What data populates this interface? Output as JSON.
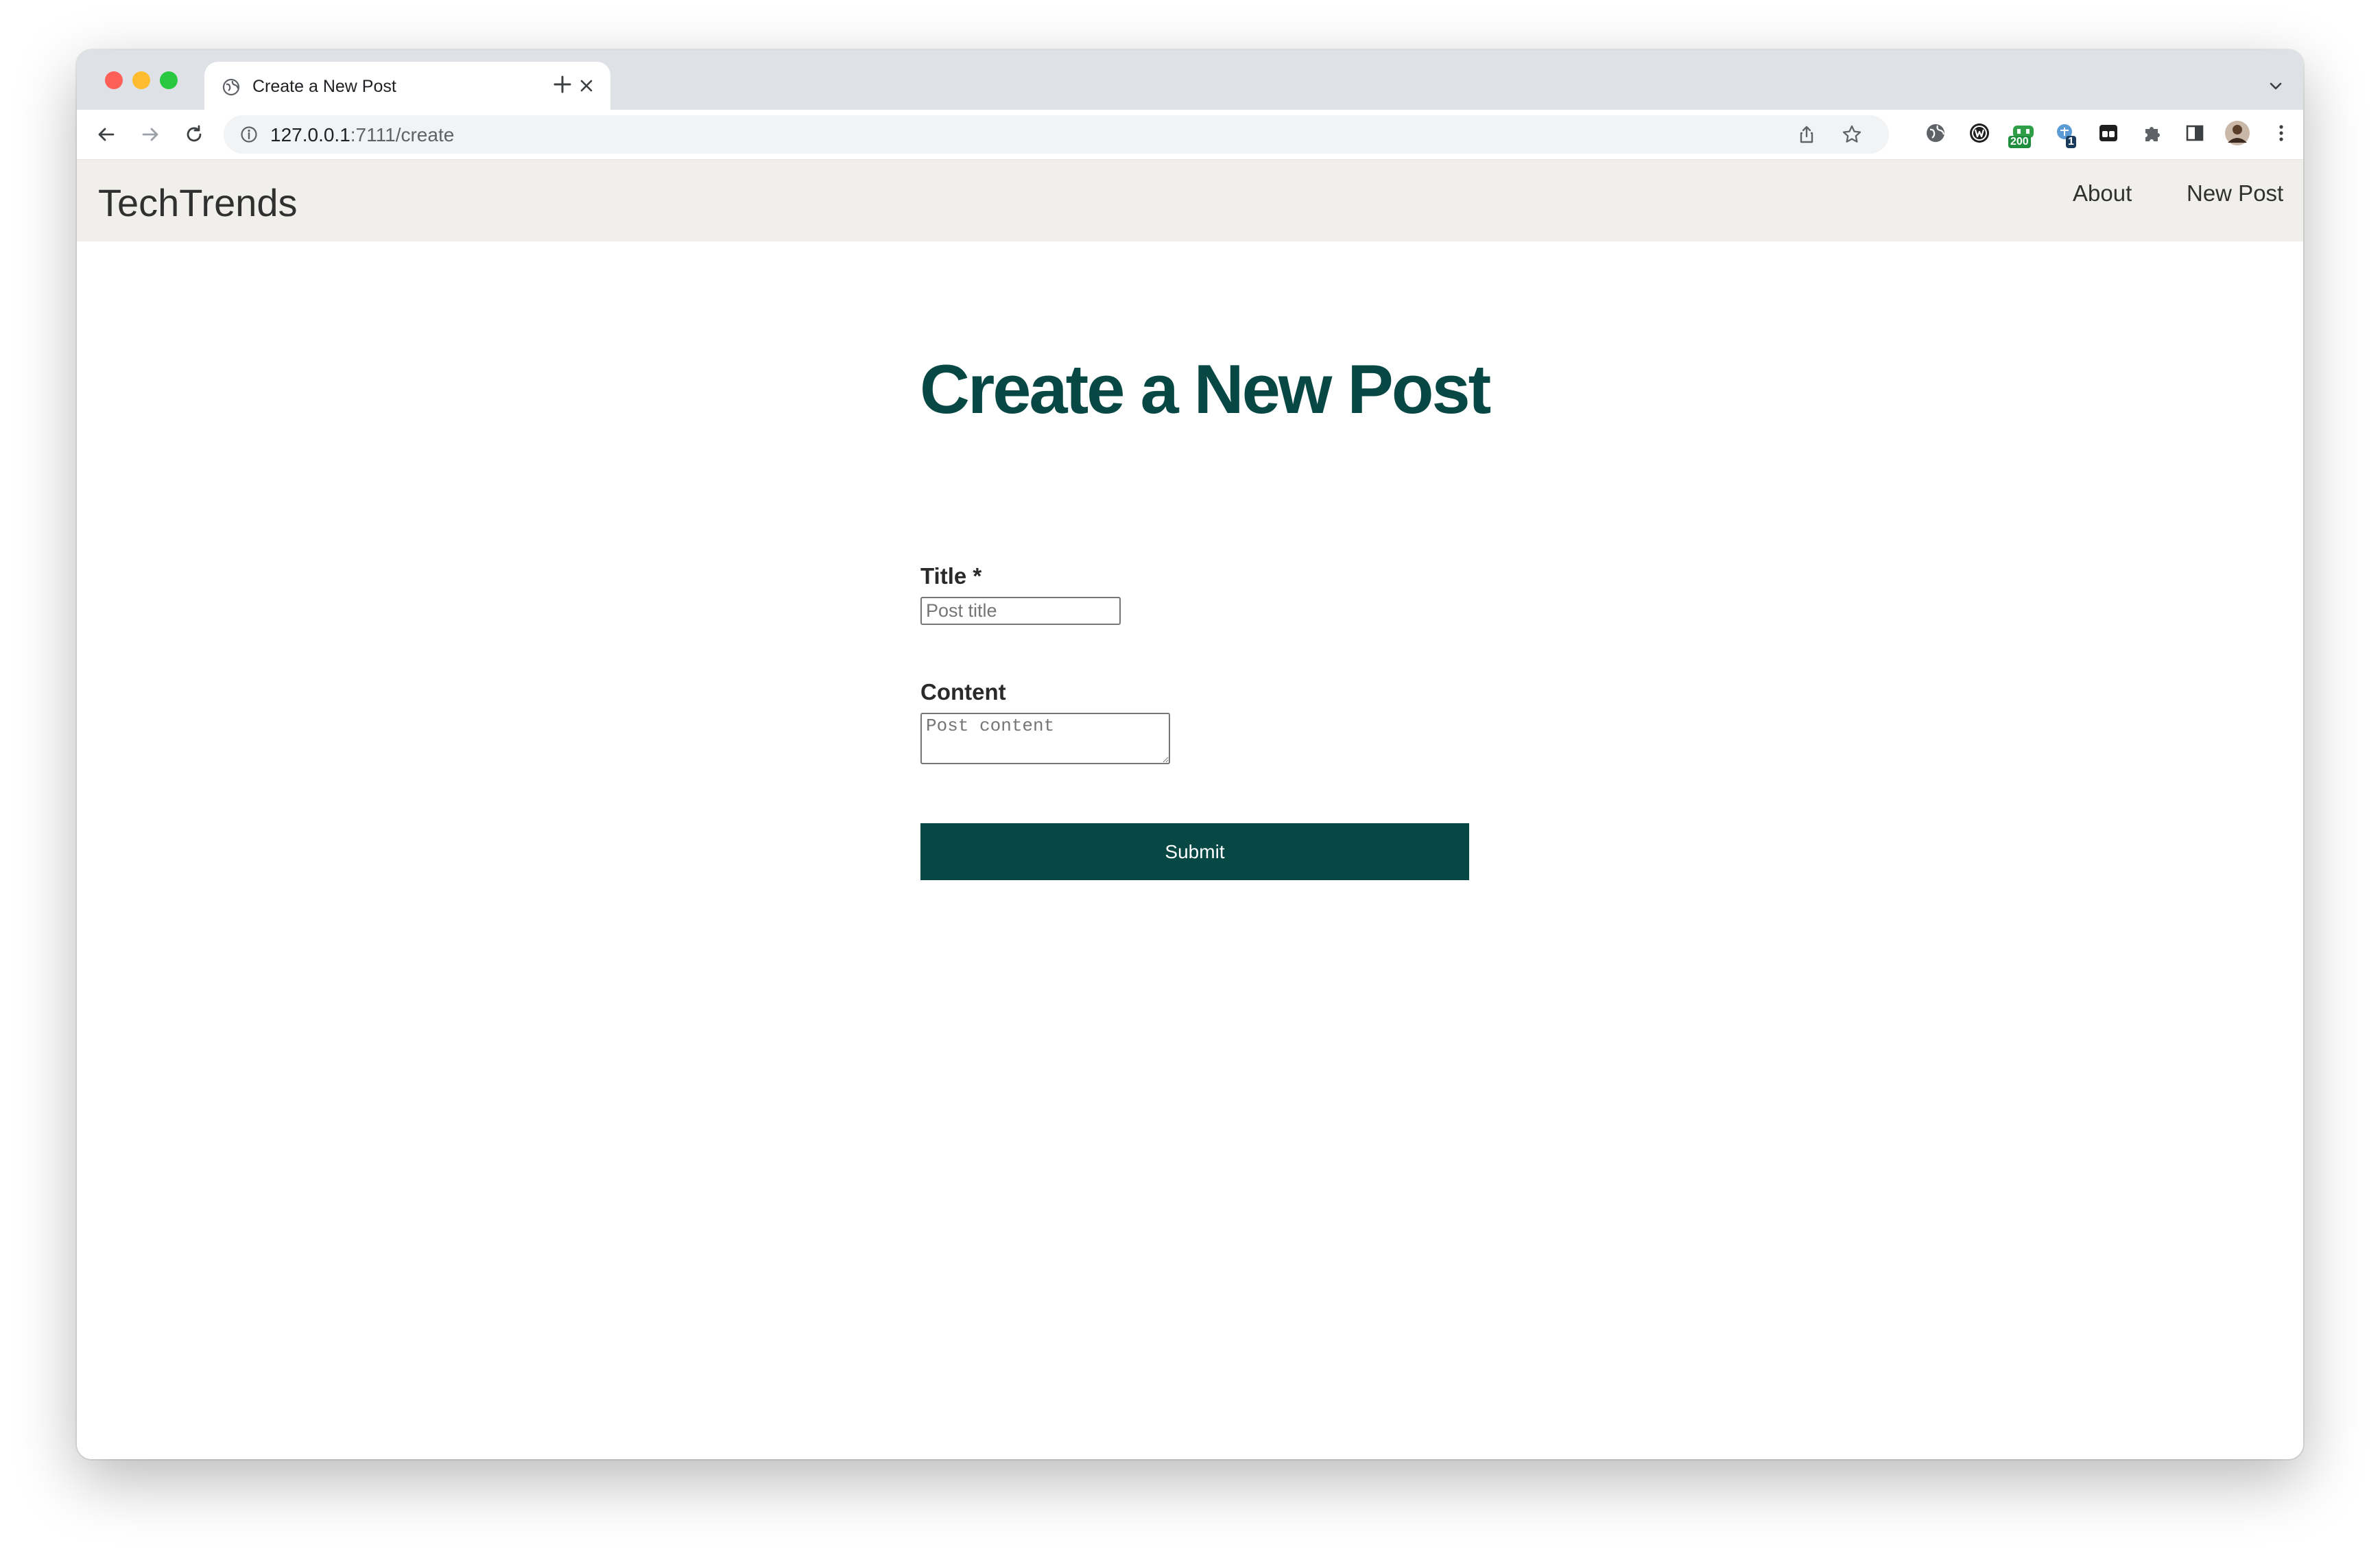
{
  "browser": {
    "tab_title": "Create a New Post",
    "url_host": "127.0.0.1",
    "url_path": ":7111/create",
    "extensions": [
      {
        "name": "ext-globe-icon"
      },
      {
        "name": "ext-w-icon"
      },
      {
        "name": "ext-green-icon",
        "badge": "200",
        "badge_color": "#1e8e3e"
      },
      {
        "name": "ext-translate-icon",
        "badge": "1",
        "badge_color": "#1a3a5c"
      },
      {
        "name": "ext-glasses-icon"
      },
      {
        "name": "extensions-puzzle-icon"
      },
      {
        "name": "side-panel-icon"
      },
      {
        "name": "profile-avatar"
      },
      {
        "name": "menu-kebab-icon"
      }
    ]
  },
  "site": {
    "brand": "TechTrends",
    "nav": {
      "about": "About",
      "new_post": "New Post"
    }
  },
  "form": {
    "heading": "Create a New Post",
    "title_label": "Title *",
    "title_placeholder": "Post title",
    "title_value": "",
    "content_label": "Content",
    "content_placeholder": "Post content",
    "content_value": "",
    "submit_label": "Submit"
  },
  "colors": {
    "accent": "#074744",
    "navbar_bg": "#f0efec",
    "tabstrip_bg": "#dee1e6"
  }
}
